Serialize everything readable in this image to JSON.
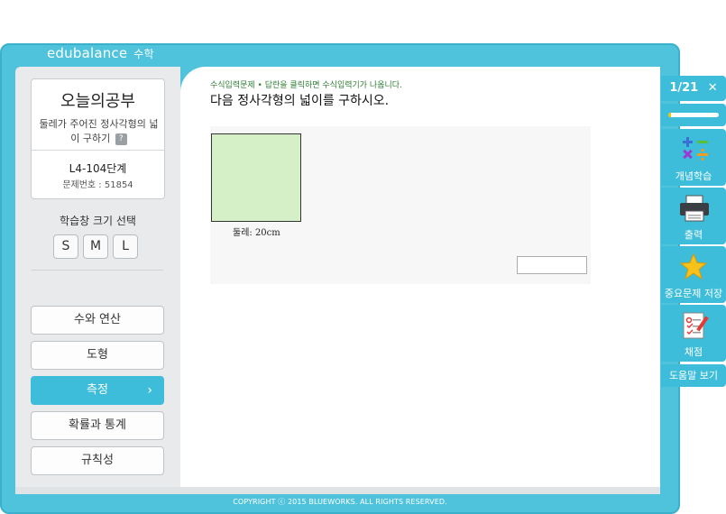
{
  "app": {
    "brand": "edubalance",
    "brand_sub": "수학"
  },
  "today": {
    "title": "오늘의공부",
    "desc": "둘레가 주어진 정사각형의 넓이 구하기",
    "help": "?",
    "level": "L4-104단계",
    "question_number": "문제번호 : 51854"
  },
  "size_select": {
    "label": "학습창 크기 선택",
    "options": [
      "S",
      "M",
      "L"
    ]
  },
  "menu": [
    {
      "label": "수와 연산",
      "active": false
    },
    {
      "label": "도형",
      "active": false
    },
    {
      "label": "측정",
      "active": true
    },
    {
      "label": "확률과 통계",
      "active": false
    },
    {
      "label": "규칙성",
      "active": false
    }
  ],
  "question": {
    "instruction": "수식입력문제 • 답란을 클릭하면 수식입력기가 나옵니다.",
    "text": "다음 정사각형의 넓이를 구하시오.",
    "figure_label": "둘레: 20cm",
    "answer_value": ""
  },
  "toolbar": {
    "page": "1/21",
    "close": "✕",
    "progress": 0.048,
    "concept": "개념학습",
    "print": "출력",
    "save": "중요문제 저장",
    "grade": "채점",
    "help": "도움말 보기"
  },
  "footer": {
    "copyright": "COPYRIGHT ⓒ 2015 BLUEWORKS. ALL RIGHTS RESERVED."
  },
  "colors": {
    "accent": "#3dbdd9",
    "frame": "#4fc3dc",
    "square_fill": "#d5efc7",
    "progress": "#f6c000"
  }
}
